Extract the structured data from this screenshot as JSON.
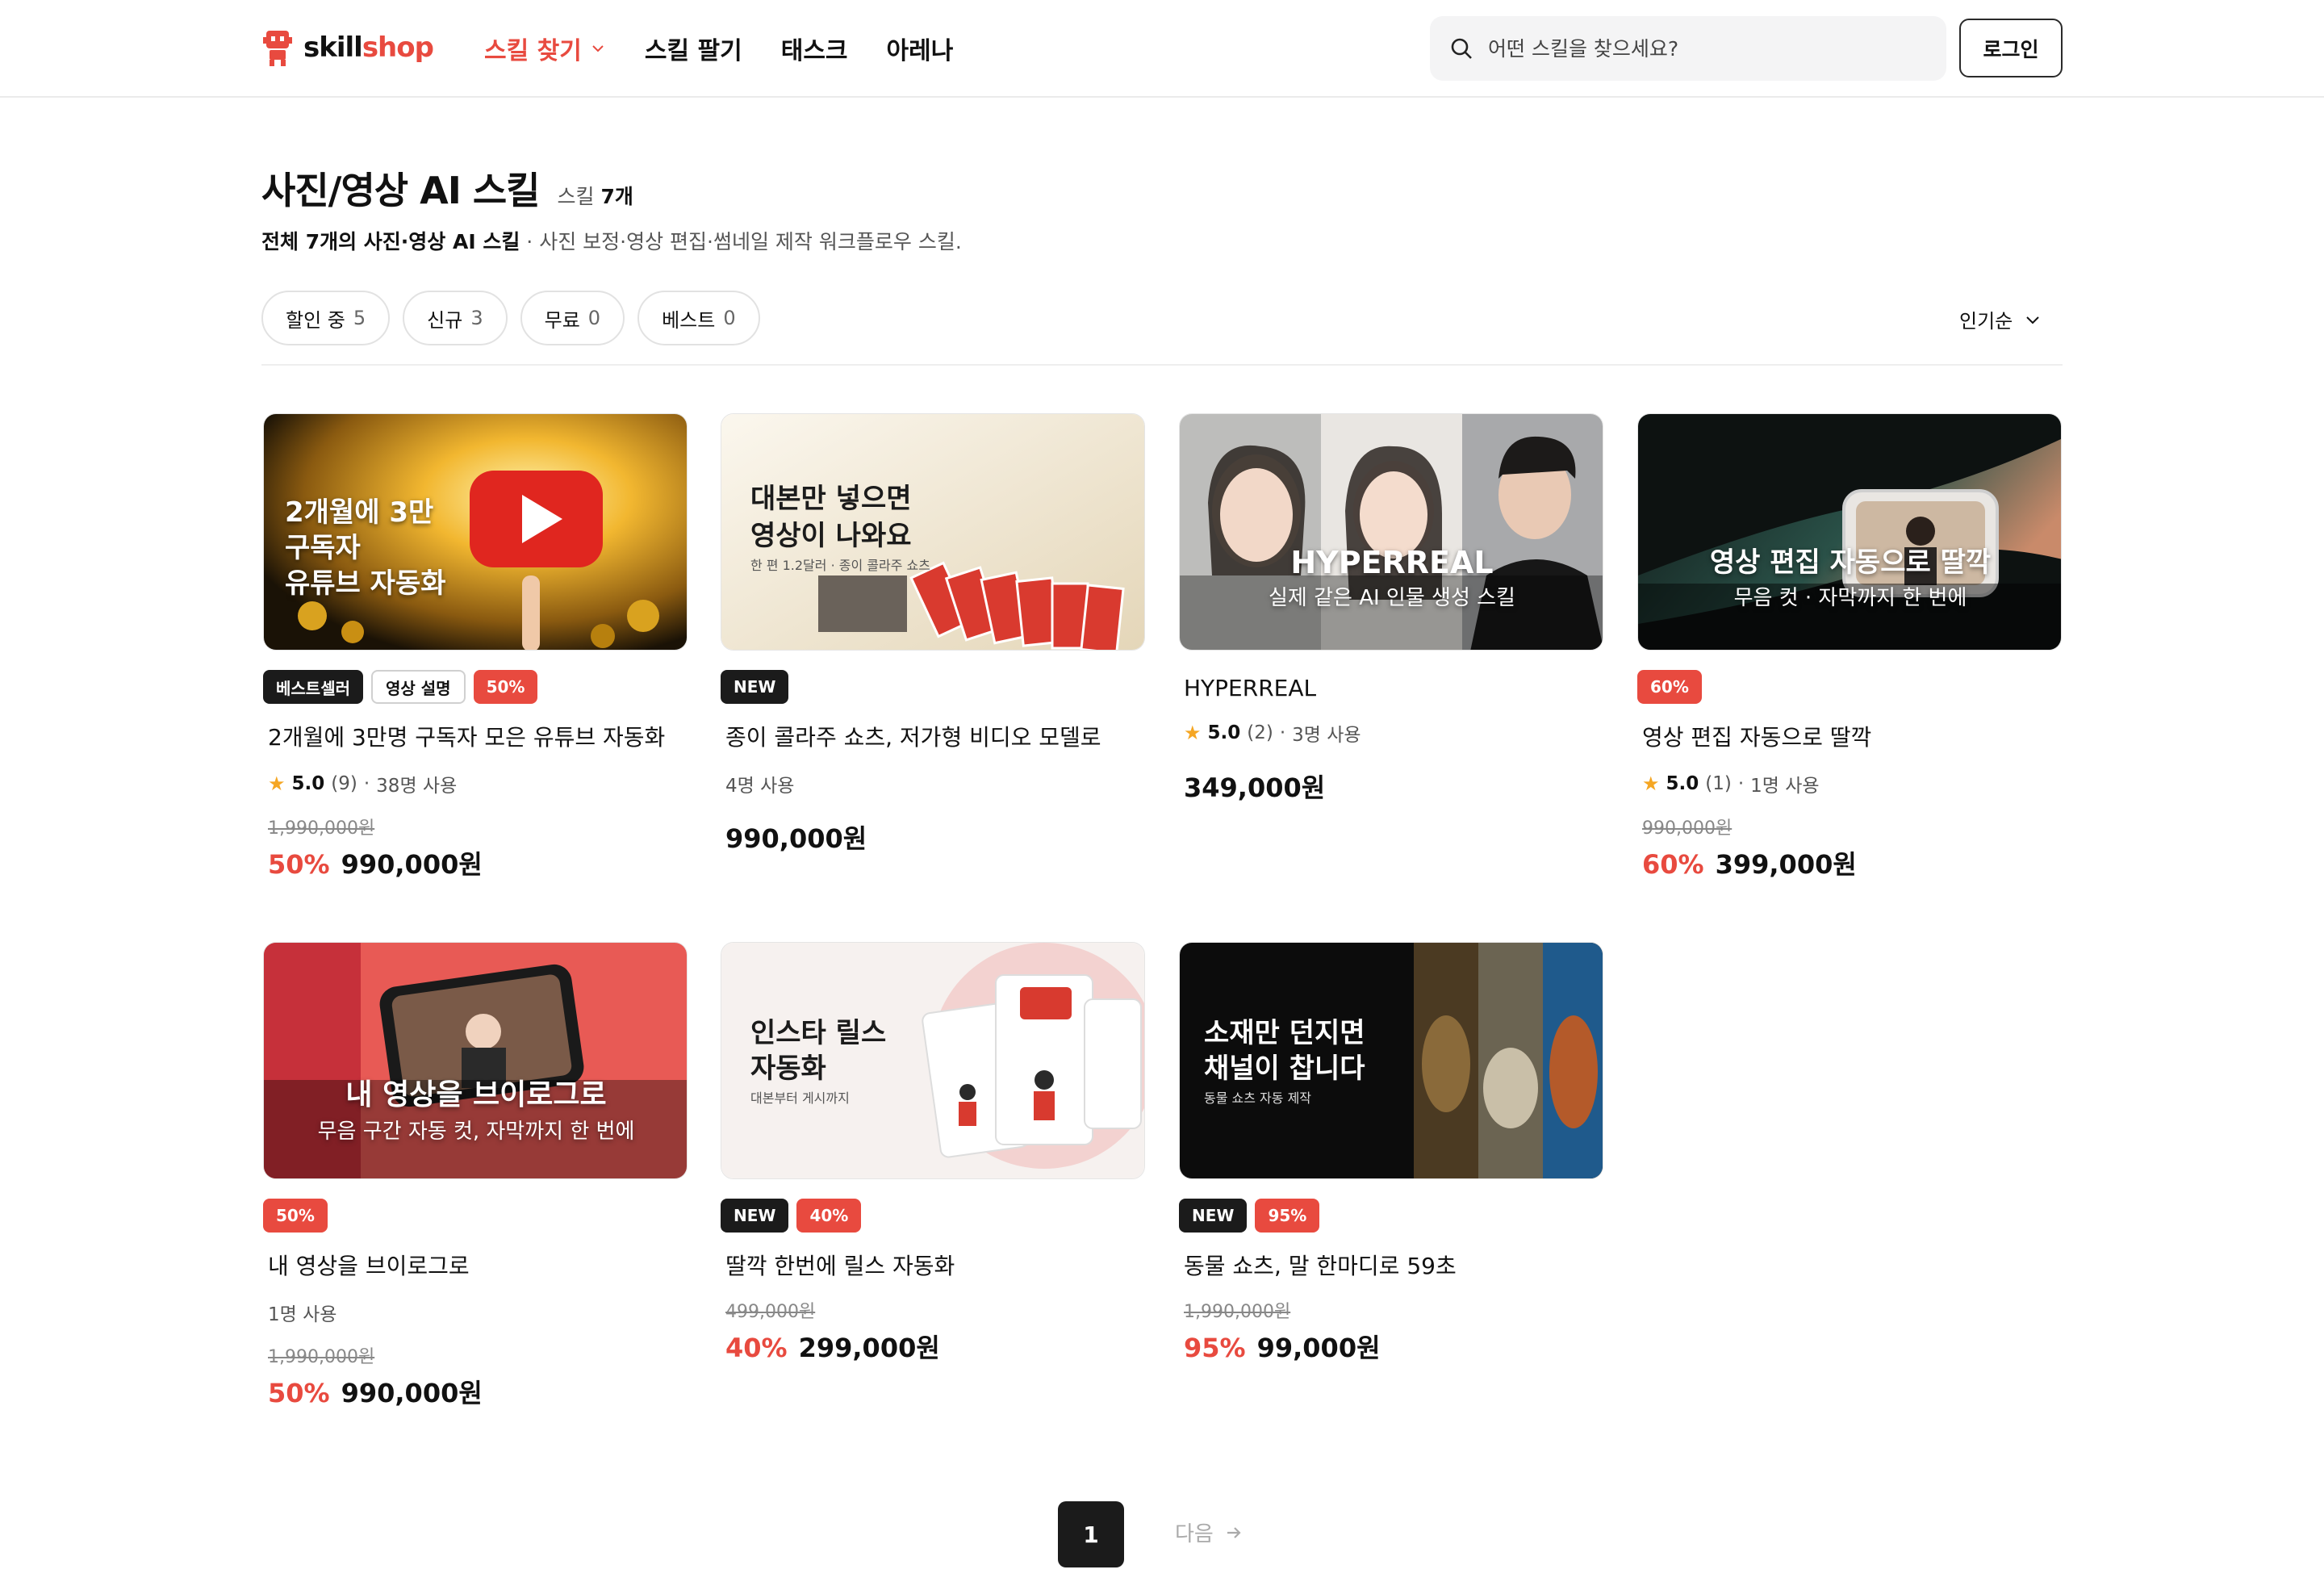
{
  "header": {
    "logo": {
      "a": "skill",
      "b": "shop"
    },
    "nav": [
      {
        "label": "스킬 찾기",
        "active": true
      },
      {
        "label": "스킬 팔기"
      },
      {
        "label": "태스크"
      },
      {
        "label": "아레나"
      }
    ],
    "search_placeholder": "어떤 스킬을 찾으세요?",
    "login_label": "로그인"
  },
  "category": {
    "title": "사진/영상 AI 스킬",
    "count_prefix": "스킬",
    "count_value": "7개",
    "desc_bold": "전체 7개의 사진·영상 AI 스킬",
    "desc_rest": " · 사진 보정·영상 편집·썸네일 제작 워크플로우 스킬."
  },
  "filters": [
    {
      "label": "할인 중",
      "count": "5"
    },
    {
      "label": "신규",
      "count": "3"
    },
    {
      "label": "무료",
      "count": "0"
    },
    {
      "label": "베스트",
      "count": "0"
    }
  ],
  "sort_label": "인기순",
  "products": [
    {
      "thumb_lines": [
        "2개월에 3만",
        "구독자",
        "유튜브 자동화"
      ],
      "badges": [
        "베스트셀러",
        "영상 설명",
        "50%"
      ],
      "name": "2개월에 3만명 구독자 모은 유튜브 자동화",
      "rating": "5.0",
      "reviews": "(9)",
      "users": "38명 사용",
      "original_price": "1,990,000원",
      "discount": "50%",
      "price": "990,000원"
    },
    {
      "thumb_lines": [
        "대본만 넣으면",
        "영상이 나와요",
        "한 편 1.2달러 · 종이 콜라주 쇼츠"
      ],
      "badges": [
        "NEW"
      ],
      "name": "종이 콜라주 쇼츠, 저가형 비디오 모델로",
      "users": "4명 사용",
      "price": "990,000원"
    },
    {
      "thumb_lines": [
        "HYPERREAL",
        "실제 같은 AI 인물 생성 스킬"
      ],
      "badges": [],
      "name": "HYPERREAL",
      "rating": "5.0",
      "reviews": "(2)",
      "users": "3명 사용",
      "price": "349,000원"
    },
    {
      "thumb_lines": [
        "영상 편집 자동으로 딸깍",
        "무음 컷 · 자막까지 한 번에"
      ],
      "badges": [
        "60%"
      ],
      "name": "영상 편집 자동으로 딸깍",
      "rating": "5.0",
      "reviews": "(1)",
      "users": "1명 사용",
      "original_price": "990,000원",
      "discount": "60%",
      "price": "399,000원"
    },
    {
      "thumb_lines": [
        "내 영상을 브이로그로",
        "무음 구간 자동 컷, 자막까지 한 번에"
      ],
      "badges": [
        "50%"
      ],
      "name": "내 영상을 브이로그로",
      "users": "1명 사용",
      "original_price": "1,990,000원",
      "discount": "50%",
      "price": "990,000원"
    },
    {
      "thumb_lines": [
        "인스타 릴스",
        "자동화",
        "대본부터 게시까지"
      ],
      "badges": [
        "NEW",
        "40%"
      ],
      "name": "딸깍 한번에 릴스 자동화",
      "original_price": "499,000원",
      "discount": "40%",
      "price": "299,000원"
    },
    {
      "thumb_lines": [
        "소재만 던지면",
        "채널이 찹니다",
        "동물 쇼츠 자동 제작"
      ],
      "badges": [
        "NEW",
        "95%"
      ],
      "name": "동물 쇼츠, 말 한마디로 59초",
      "original_price": "1,990,000원",
      "discount": "95%",
      "price": "99,000원"
    }
  ],
  "pagination": {
    "current": "1",
    "next_label": "다음"
  },
  "colors": {
    "accent": "#e84a3f",
    "dark": "#1b1b1b"
  }
}
